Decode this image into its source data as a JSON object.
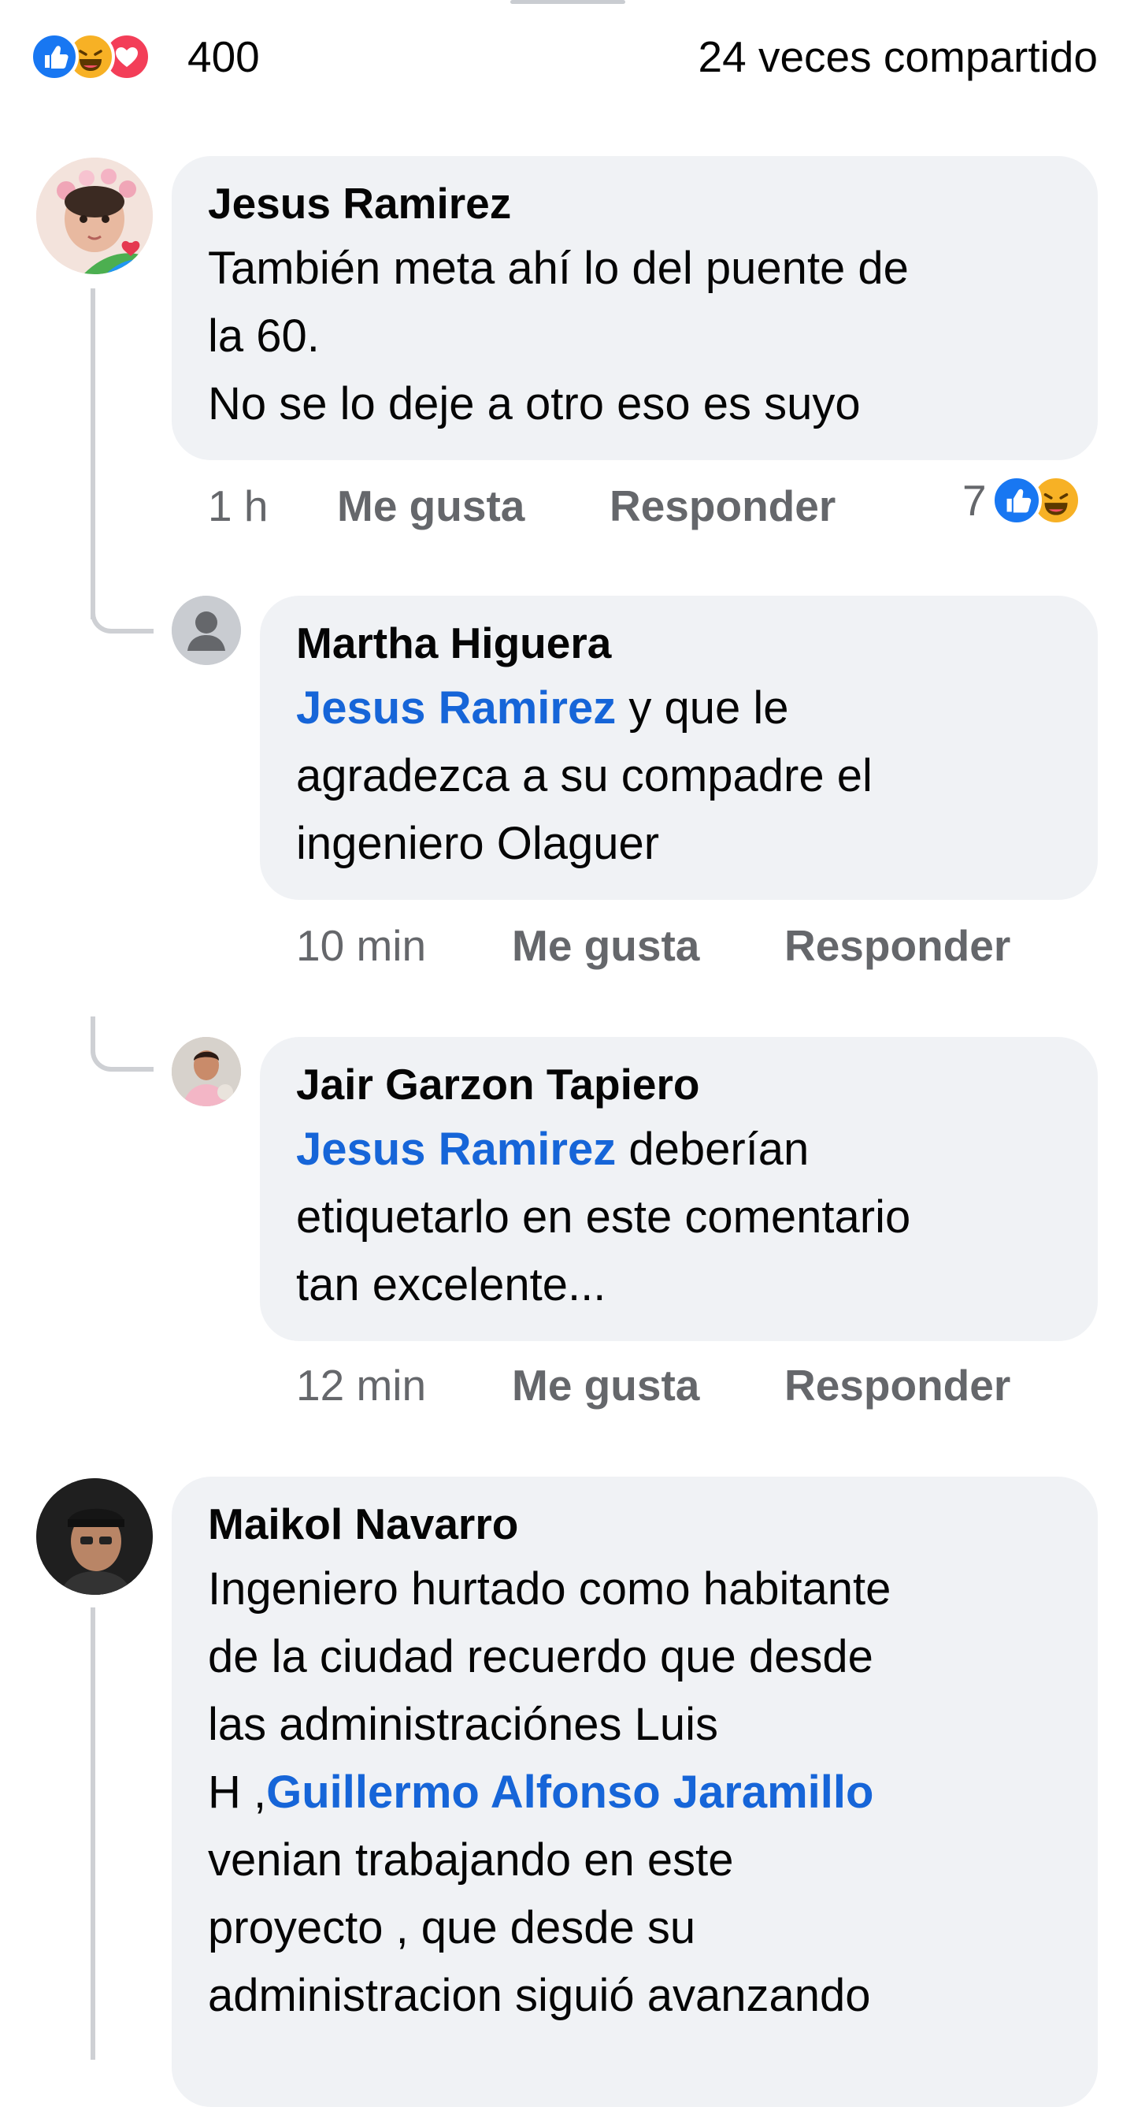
{
  "summary": {
    "reaction_icons": [
      "like-reaction-icon",
      "haha-reaction-icon",
      "love-reaction-icon"
    ],
    "total_reactions": "400",
    "shares": "24 veces compartido"
  },
  "colors": {
    "like": "#1877f2",
    "haha": "#f7b125",
    "love": "#f33e58",
    "mention": "#1665d8",
    "bubble": "#f0f2f5",
    "meta_text": "#65676b"
  },
  "comments": [
    {
      "author": "Jesus Ramirez",
      "lines": [
        "También meta ahí lo del puente de",
        "la 60.",
        "No se lo deje a otro eso es suyo"
      ],
      "time": "1 h",
      "like_label": "Me gusta",
      "reply_label": "Responder",
      "reaction_count": "7",
      "reaction_icons": [
        "like-reaction-icon",
        "haha-reaction-icon"
      ]
    },
    {
      "author": "Martha Higuera",
      "mention": "Jesus Ramirez",
      "lines": [
        " y que le",
        "agradezca a su compadre el",
        "ingeniero Olaguer"
      ],
      "time": "10 min",
      "like_label": "Me gusta",
      "reply_label": "Responder"
    },
    {
      "author": "Jair Garzon Tapiero",
      "mention": "Jesus Ramirez",
      "lines": [
        " deberían",
        "etiquetarlo en este comentario",
        "tan excelente..."
      ],
      "time": "12 min",
      "like_label": "Me gusta",
      "reply_label": "Responder"
    },
    {
      "author": "Maikol Navarro",
      "mention": "Guillermo Alfonso Jaramillo",
      "lines": [
        "Ingeniero hurtado  como habitante",
        "de la ciudad recuerdo que desde",
        "las administraciónes  Luis",
        "H ,",
        "venian trabajando en este",
        "proyecto , que desde su",
        "administracion siguió avanzando"
      ]
    }
  ]
}
